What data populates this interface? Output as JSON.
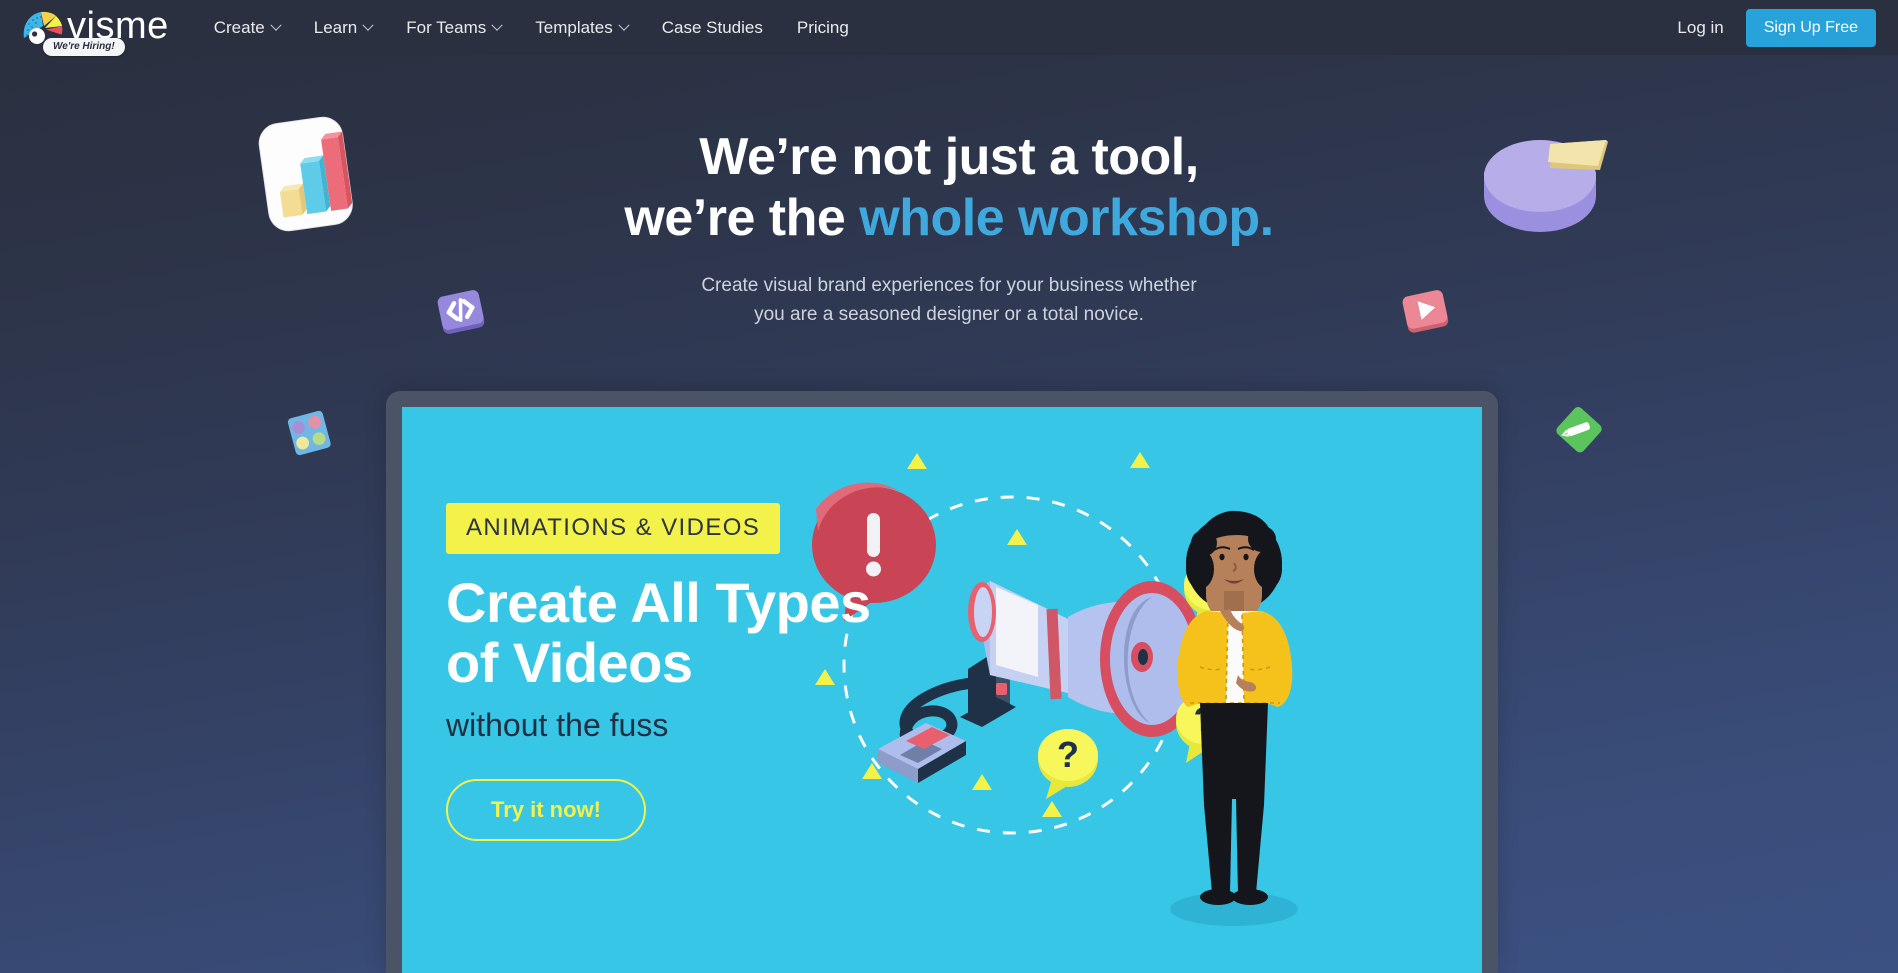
{
  "nav": {
    "logo_word": "visme",
    "logo_icon": "visme-fan-logo-icon",
    "hiring_badge": "We're Hiring!",
    "items": [
      {
        "label": "Create",
        "has_caret": true
      },
      {
        "label": "Learn",
        "has_caret": true
      },
      {
        "label": "For Teams",
        "has_caret": true
      },
      {
        "label": "Templates",
        "has_caret": true
      },
      {
        "label": "Case Studies",
        "has_caret": false
      },
      {
        "label": "Pricing",
        "has_caret": false
      }
    ],
    "login_label": "Log in",
    "signup_label": "Sign Up Free",
    "signup_color": "#27a2db",
    "bar_color": "#2b3040"
  },
  "hero": {
    "title_line1": "We’re not just a tool,",
    "title_line2_plain": "we’re the ",
    "title_line2_accent": "whole workshop.",
    "accent_color": "#3fa9dd",
    "subtitle_line1": "Create visual brand experiences for your business whether",
    "subtitle_line2": "you are a seasoned designer or a total novice."
  },
  "floating_icons": [
    {
      "name": "bar-chart-3d-icon",
      "colors": [
        "#ffffff",
        "#f3d77f",
        "#5ec8e8",
        "#e8606d"
      ]
    },
    {
      "name": "pie-chart-3d-icon",
      "colors": [
        "#b1a6ee",
        "#f4e3a3"
      ]
    },
    {
      "name": "code-embed-icon",
      "colors": [
        "#8b7fd4",
        "#ffffff"
      ]
    },
    {
      "name": "video-play-icon",
      "colors": [
        "#e8818f",
        "#ffffff"
      ]
    },
    {
      "name": "color-palette-icon",
      "colors": [
        "#63b3e8",
        "#a98ed6",
        "#e88fa8",
        "#f0e89a",
        "#b8dc86"
      ]
    },
    {
      "name": "pen-tool-icon",
      "colors": [
        "#5cc45c",
        "#ffffff"
      ]
    }
  ],
  "banner": {
    "bg_color": "#37c6e5",
    "frame_color": "#4b5366",
    "tag": "ANIMATIONS & VIDEOS",
    "tag_bg": "#f2f24a",
    "heading": "Create All Types\nof Videos",
    "subheading": "without the fuss",
    "cta_label": "Try it now!",
    "cta_color": "#f2f24a",
    "illustration": "megaphone-with-speech-bubbles",
    "character": "woman-in-yellow-cardigan"
  }
}
